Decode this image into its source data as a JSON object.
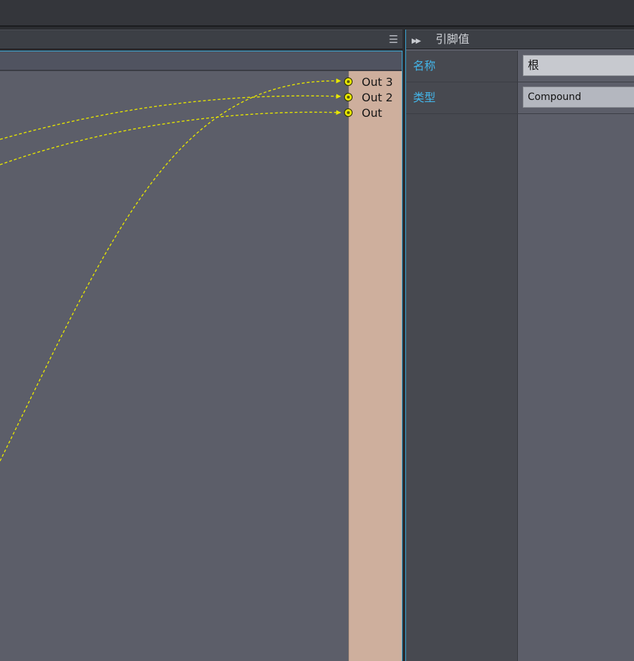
{
  "graph": {
    "menu_icon": "hamburger-menu-icon",
    "output_ports": [
      {
        "label": "Out 3"
      },
      {
        "label": "Out 2"
      },
      {
        "label": "Out"
      }
    ],
    "wire_color": "#e6e500",
    "node_color": "#ceaf9d",
    "canvas_color": "#5c5e69",
    "accent_color": "#3aa9d8"
  },
  "properties": {
    "header_icon": "double-arrow-right-icon",
    "title": "引脚值",
    "rows": [
      {
        "label": "名称",
        "value": "根"
      },
      {
        "label": "类型",
        "value": "Compound"
      }
    ],
    "label_color": "#43b6ea"
  }
}
